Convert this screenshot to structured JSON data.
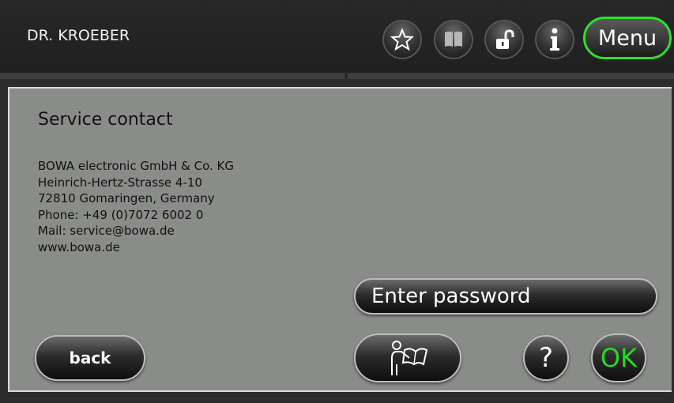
{
  "header": {
    "user_name": "DR. KROEBER",
    "menu_label": "Menu",
    "icons": [
      "star-icon",
      "book-icon",
      "unlock-icon",
      "info-icon"
    ]
  },
  "service": {
    "title": "Service contact",
    "lines": [
      "BOWA electronic GmbH & Co. KG",
      "Heinrich-Hertz-Strasse 4-10",
      "72810 Gomaringen, Germany",
      "Phone: +49 (0)7072 6002 0",
      "Mail: service@bowa.de",
      "www.bowa.de"
    ]
  },
  "buttons": {
    "enter_password": "Enter password",
    "back": "back",
    "help": "?",
    "ok": "OK"
  },
  "colors": {
    "accent_green": "#2ee02e",
    "panel_bg": "#8a8c89",
    "header_bg": "#272827"
  }
}
